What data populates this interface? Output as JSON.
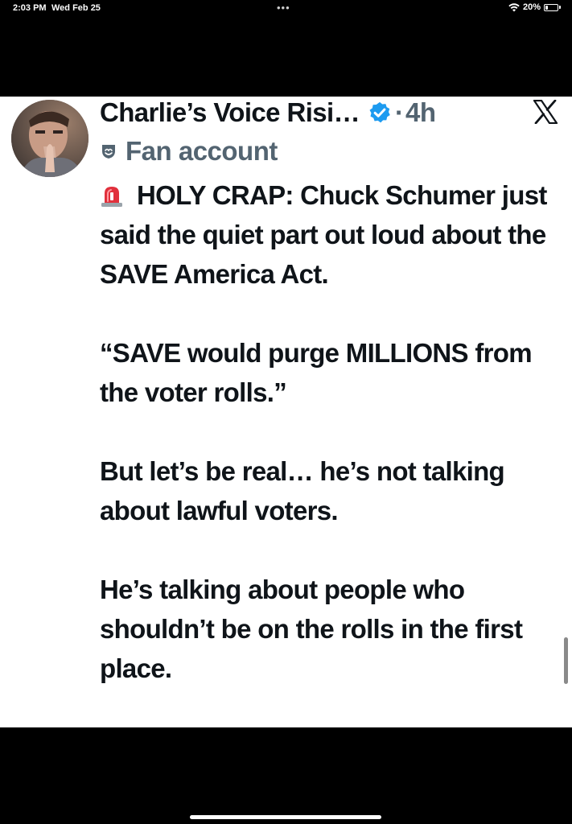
{
  "status_bar": {
    "time": "2:03 PM",
    "date": "Wed Feb 25",
    "dots": "•••",
    "battery_percent": "20%",
    "battery_level": 0.2,
    "wifi_icon": "wifi-icon"
  },
  "post": {
    "author_name": "Charlie’s Voice Risi…",
    "dot": "·",
    "time": "4h",
    "label": "Fan account",
    "icons": {
      "verified": "verified-badge-icon",
      "platform": "x-logo-icon",
      "label": "fan-account-icon",
      "siren": "siren-emoji-icon"
    },
    "colors": {
      "verified_blue": "#1d9bf0",
      "text": "#0f1419",
      "muted": "#536471"
    },
    "paragraph_1": "HOLY CRAP: Chuck Schumer just said the quiet part out loud about the SAVE America Act.",
    "paragraph_2": "“SAVE would purge MILLIONS from the voter rolls.”",
    "paragraph_3": "But let’s be real… he’s not talking about lawful voters.",
    "paragraph_4": "He’s talking about people who shouldn’t be on the rolls in the first place."
  }
}
